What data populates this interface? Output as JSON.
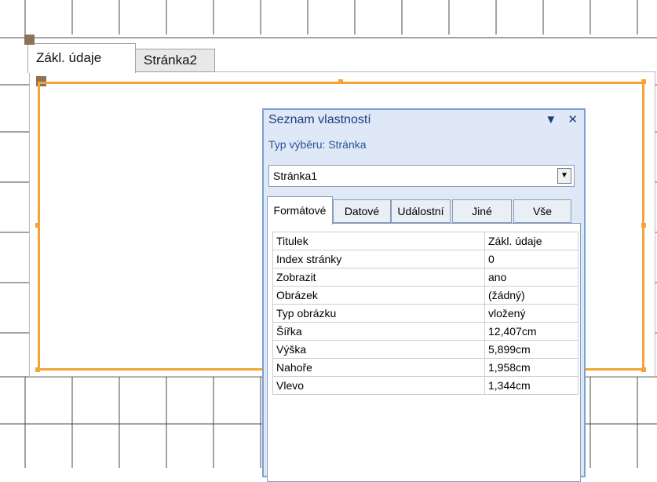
{
  "form": {
    "tabs": [
      {
        "label": "Zákl. údaje",
        "active": true
      },
      {
        "label": "Stránka2",
        "active": false
      }
    ],
    "accent_color": "#f5a43a"
  },
  "property_sheet": {
    "title": "Seznam vlastností",
    "selection_type_label": "Typ výběru:",
    "selection_type_value": "Stránka",
    "selected_object": "Stránka1",
    "tabs": [
      {
        "label": "Formátové",
        "active": true
      },
      {
        "label": "Datové",
        "active": false
      },
      {
        "label": "Událostní",
        "active": false
      },
      {
        "label": "Jiné",
        "active": false
      },
      {
        "label": "Vše",
        "active": false
      }
    ],
    "properties": [
      {
        "name": "Titulek",
        "value": "Zákl. údaje"
      },
      {
        "name": "Index stránky",
        "value": "0"
      },
      {
        "name": "Zobrazit",
        "value": "ano"
      },
      {
        "name": "Obrázek",
        "value": "(žádný)"
      },
      {
        "name": "Typ obrázku",
        "value": "vložený"
      },
      {
        "name": "Šířka",
        "value": "12,407cm"
      },
      {
        "name": "Výška",
        "value": "5,899cm"
      },
      {
        "name": "Nahoře",
        "value": "1,958cm"
      },
      {
        "name": "Vlevo",
        "value": "1,344cm"
      }
    ],
    "icons": {
      "dropdown": "chevron-down-icon",
      "close": "close-icon",
      "menu": "triangle-down-icon"
    }
  }
}
